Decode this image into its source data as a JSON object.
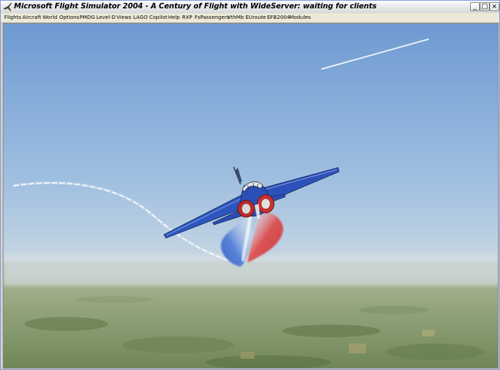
{
  "window": {
    "title": "Microsoft Flight Simulator 2004 - A Century of Flight with WideServer: waiting for clients",
    "minimize_label": "_",
    "maximize_label": "□",
    "close_label": "×"
  },
  "menu": {
    "items": [
      {
        "label": "Flights"
      },
      {
        "label": "Aircraft"
      },
      {
        "label": "World"
      },
      {
        "label": "Options"
      },
      {
        "label": "PMDG"
      },
      {
        "label": "Level-D"
      },
      {
        "label": "Views"
      },
      {
        "label": "LAGO"
      },
      {
        "label": "Copilot"
      },
      {
        "label": "Help"
      },
      {
        "label": "RXP"
      },
      {
        "label": "FsPassengers"
      },
      {
        "label": "VthMb"
      },
      {
        "label": "EUroute"
      },
      {
        "label": "EFB2004"
      },
      {
        "label": "Modules"
      }
    ]
  },
  "colors": {
    "sky_top": "#6f9bd3",
    "sky_horizon": "#d8e2e6",
    "ground": "#8a9c72",
    "smoke_blue": "#3f6fd6",
    "smoke_red": "#d23a3a",
    "aircraft_blue": "#2b4fb8"
  }
}
